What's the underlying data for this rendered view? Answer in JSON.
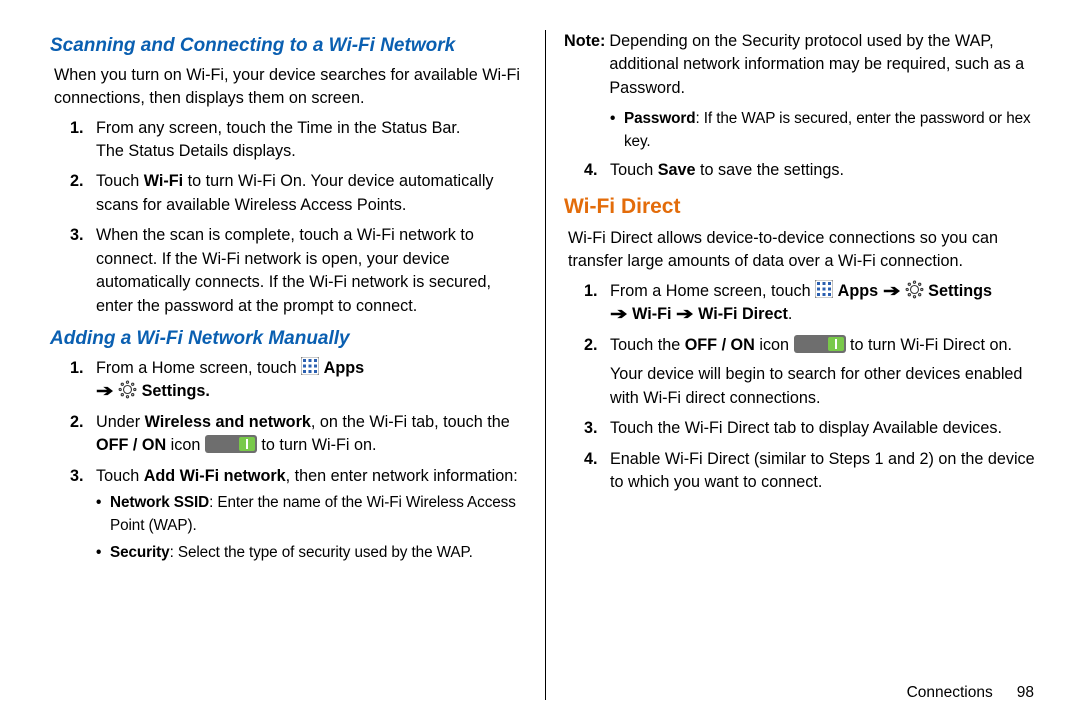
{
  "left": {
    "h1": "Scanning and Connecting to a Wi-Fi Network",
    "intro": "When you turn on Wi-Fi, your device searches for available Wi-Fi connections, then displays them on screen.",
    "step1_a": "From any screen, touch the Time in the Status Bar.",
    "step1_b": "The Status Details displays.",
    "step2_a": "Touch ",
    "step2_b": "Wi-Fi",
    "step2_c": " to turn Wi-Fi On. Your device automatically scans for available Wireless Access Points.",
    "step3": "When the scan is complete, touch a Wi-Fi network to connect. If the Wi-Fi network is open, your device automatically connects. If the Wi-Fi network is secured, enter the password at the prompt to connect.",
    "h2": "Adding a Wi-Fi Network Manually",
    "m1_a": "From a Home screen, touch ",
    "m1_apps": "Apps",
    "m1_settings": "Settings.",
    "m2_a": "Under ",
    "m2_b": "Wireless and network",
    "m2_c": ", on the Wi-Fi tab, touch the ",
    "m2_d": "OFF / ON",
    "m2_e": " icon ",
    "m2_f": " to turn Wi-Fi on.",
    "m3_a": "Touch ",
    "m3_b": "Add Wi-Fi network",
    "m3_c": ", then enter network information:",
    "sb1_a": "Network SSID",
    "sb1_b": ": Enter the name of the Wi-Fi Wireless Access Point (WAP).",
    "sb2_a": "Security",
    "sb2_b": ": Select the type of security used by the WAP."
  },
  "right": {
    "note_label": "Note:",
    "note_body": "Depending on the Security protocol used by the WAP, additional network information may be required, such as a Password.",
    "pw_a": "Password",
    "pw_b": ": If the WAP is secured, enter the password or hex key.",
    "s4_a": "Touch ",
    "s4_b": "Save",
    "s4_c": " to save the settings.",
    "h3": "Wi-Fi Direct",
    "intro2": "Wi-Fi Direct allows device-to-device connections so you can transfer large amounts of data over a Wi-Fi connection.",
    "d1_a": "From a Home screen, touch ",
    "d1_apps": "Apps",
    "d1_settings": "Settings",
    "d1_wifi": "Wi-Fi",
    "d1_wfd": "Wi-Fi Direct",
    "d2_a": "Touch the ",
    "d2_b": "OFF / ON",
    "d2_c": " icon ",
    "d2_d": " to turn Wi-Fi Direct on.",
    "d2_e": "Your device will begin to search for other devices enabled with Wi-Fi direct connections.",
    "d3": "Touch the Wi-Fi Direct tab to display Available devices.",
    "d4": "Enable Wi-Fi Direct (similar to Steps 1 and 2) on the device to which you want to connect."
  },
  "footer": {
    "section": "Connections",
    "page": "98"
  },
  "arrow": "➔",
  "period": "."
}
